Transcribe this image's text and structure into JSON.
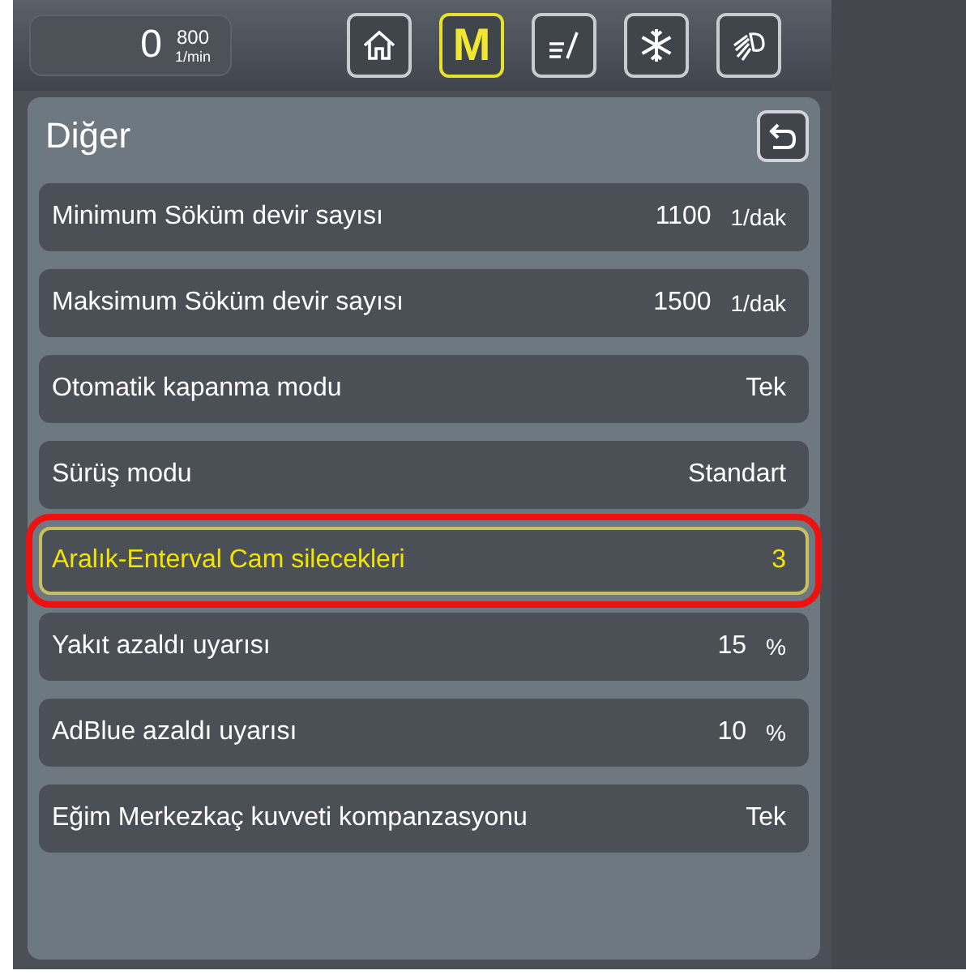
{
  "top_bar": {
    "speed": "0",
    "rpm_target": "800",
    "rpm_unit": "1/min",
    "buttons": [
      {
        "kind": "home",
        "selected": false
      },
      {
        "kind": "text",
        "label": "M",
        "selected": true
      },
      {
        "kind": "edit",
        "selected": false
      },
      {
        "kind": "snowflake",
        "selected": false
      },
      {
        "kind": "light",
        "selected": false
      }
    ]
  },
  "panel": {
    "title": "Diğer",
    "rows": [
      {
        "label": "Minimum Söküm devir sayısı",
        "value": "1100",
        "unit": "1/dak",
        "selected": false
      },
      {
        "label": "Maksimum Söküm devir sayısı",
        "value": "1500",
        "unit": "1/dak",
        "selected": false
      },
      {
        "label": "Otomatik kapanma modu",
        "value": "Tek",
        "selected": false
      },
      {
        "label": "Sürüş modu",
        "value": "Standart",
        "selected": false
      },
      {
        "label": "Aralık-Enterval Cam silecekleri",
        "value": "3",
        "selected": true
      },
      {
        "label": "Yakıt azaldı uyarısı",
        "value": "15",
        "unit": "%",
        "selected": false
      },
      {
        "label": "AdBlue azaldı uyarısı",
        "value": "10",
        "unit": "%",
        "selected": false
      },
      {
        "label": "Eğim Merkezkaç kuvveti kompanzasyonu",
        "value": "Tek",
        "selected": false
      }
    ]
  }
}
